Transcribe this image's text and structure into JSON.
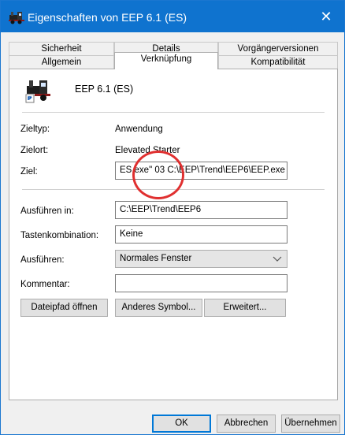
{
  "window": {
    "title": "Eigenschaften von EEP 6.1 (ES)",
    "close_glyph": "✕"
  },
  "tabs": {
    "row1": [
      "Sicherheit",
      "Details",
      "Vorgängerversionen"
    ],
    "row2": [
      "Allgemein",
      "Verknüpfung",
      "Kompatibilität"
    ],
    "active": "Verknüpfung"
  },
  "shortcut": {
    "name": "EEP 6.1 (ES)",
    "icon": "steam-locomotive-icon",
    "zieltyp_label": "Zieltyp:",
    "zieltyp_value": "Anwendung",
    "zielort_label": "Zielort:",
    "zielort_value": "Elevated Starter",
    "ziel_label": "Ziel:",
    "ziel_value": "ES.exe\" 03 C:\\EEP\\Trend\\EEP6\\EEP.exe",
    "ausfuehren_in_label": "Ausführen in:",
    "ausfuehren_in_value": "C:\\EEP\\Trend\\EEP6",
    "tastenkombination_label": "Tastenkombination:",
    "tastenkombination_value": "Keine",
    "ausfuehren_label": "Ausführen:",
    "ausfuehren_value": "Normales Fenster",
    "kommentar_label": "Kommentar:",
    "kommentar_value": ""
  },
  "panel_buttons": {
    "open_location": "Dateipfad öffnen",
    "change_icon": "Anderes Symbol...",
    "advanced": "Erweitert..."
  },
  "dialog_buttons": {
    "ok": "OK",
    "cancel": "Abbrechen",
    "apply": "Übernehmen"
  },
  "colors": {
    "titlebar": "#0f73cf",
    "annotation_circle": "#e03030",
    "default_button_border": "#0078d7"
  }
}
